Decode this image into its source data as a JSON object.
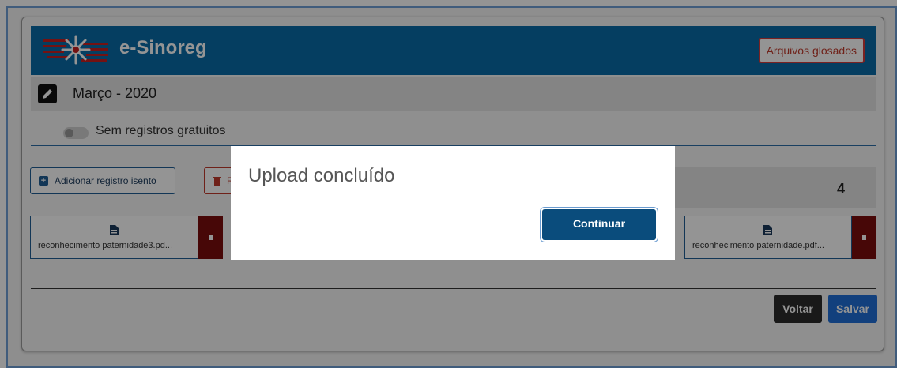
{
  "header": {
    "brand": "e-Sinoreg",
    "glosados_button": "Arquivos glosados"
  },
  "period": {
    "title": "Março - 2020"
  },
  "toggle": {
    "label": "Sem registros gratuitos",
    "checked": false
  },
  "actions": {
    "add_label": "Adicionar registro isento",
    "remove_label": "R"
  },
  "count": {
    "value": "4"
  },
  "files": [
    {
      "name": "reconhecimento paternidade3.pd..."
    },
    {
      "name": "reconhecimento paternidade.pdf..."
    }
  ],
  "footer": {
    "back_label": "Voltar",
    "save_label": "Salvar"
  },
  "modal": {
    "title": "Upload concluído",
    "continue_label": "Continuar"
  },
  "colors": {
    "header_bg": "#0a6ca8",
    "file_delete": "#7b0d0d",
    "primary": "#1f6fd8",
    "modal_button": "#0a4c7c"
  },
  "icons": [
    "edit-icon",
    "plus-icon",
    "trash-icon",
    "pdf-file-icon"
  ]
}
